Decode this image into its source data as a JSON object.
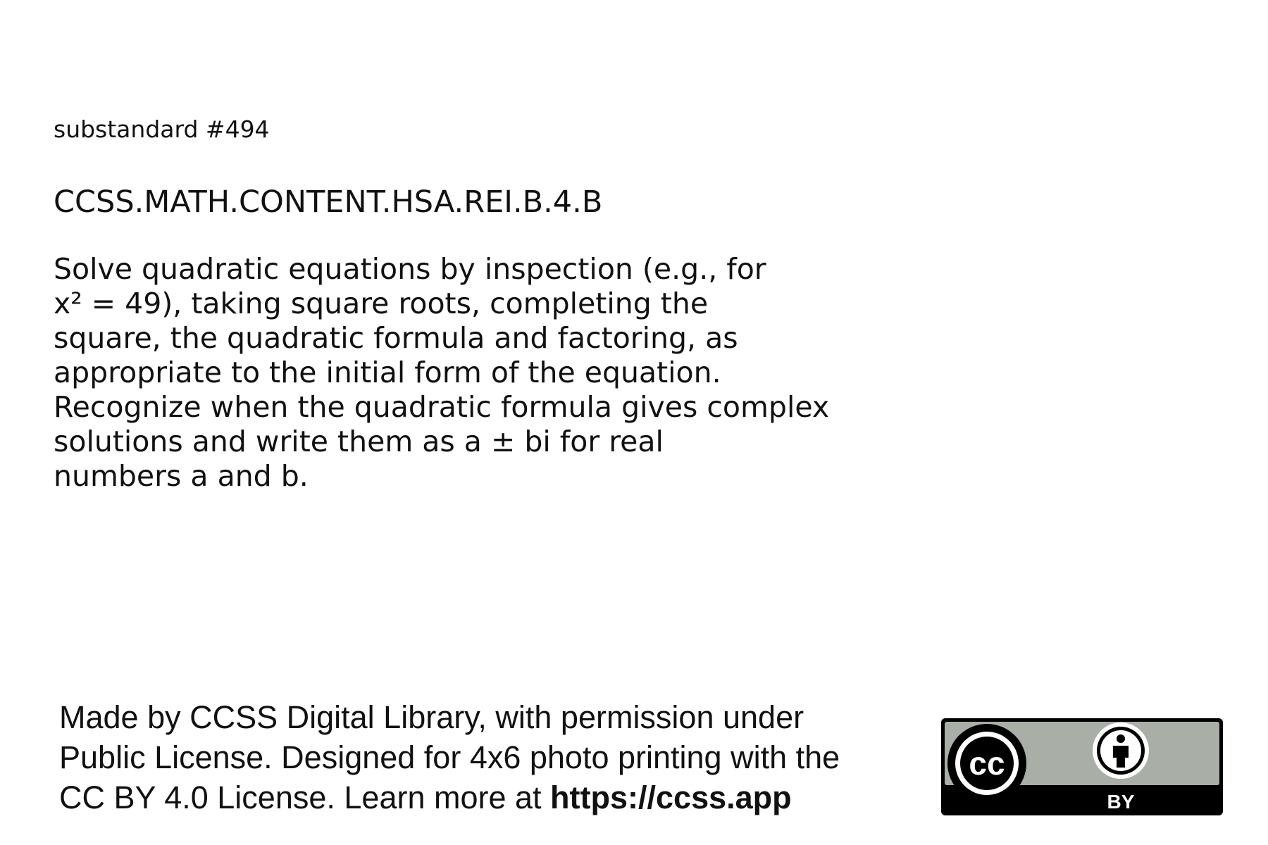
{
  "card": {
    "substandard_label": "substandard #494",
    "code": "CCSS.MATH.CONTENT.HSA.REI.B.4.B",
    "description_lines": [
      "Solve quadratic equations by inspection (e.g., for",
      "x² = 49), taking square roots, completing the",
      "square, the quadratic formula and factoring, as",
      "appropriate to the initial form of the equation.",
      "Recognize when the quadratic formula gives complex",
      "solutions and write them as a ± bi for real",
      "numbers a and b."
    ]
  },
  "footer": {
    "line1": "Made by CCSS Digital Library, with permission under",
    "line2": "Public License. Designed for 4x6 photo printing with the",
    "line3_prefix": "CC BY 4.0 License. Learn more at ",
    "line3_link": "https://ccss.app"
  },
  "license_badge": {
    "cc_text": "cc",
    "by_text": "BY",
    "icon": "cc-by-icon",
    "colors": {
      "panel": "#a9aea7",
      "border": "#000000",
      "band": "#000000",
      "text_light": "#ffffff"
    }
  }
}
